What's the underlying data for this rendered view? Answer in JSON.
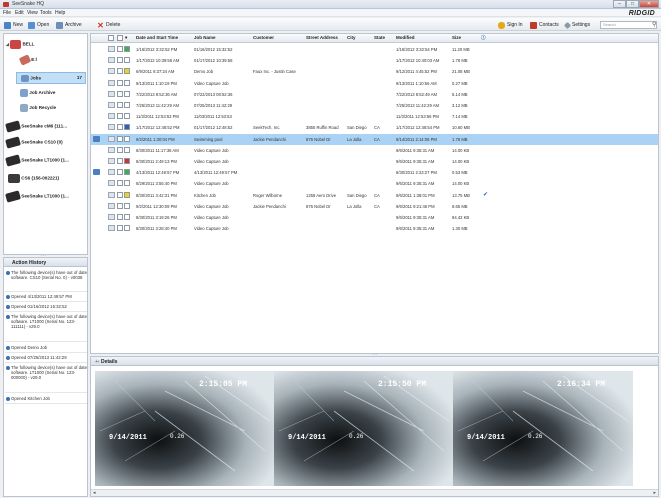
{
  "window": {
    "title": "SeeSnake HQ",
    "brand": "RIDGID"
  },
  "menu": [
    "File",
    "Edit",
    "View",
    "Tools",
    "Help"
  ],
  "toolbar": {
    "new": "New",
    "open": "Open",
    "archive": "Archive",
    "delete": "Delete",
    "sign_in": "Sign In",
    "contacts": "Contacts",
    "settings": "Settings",
    "search_placeholder": "Search"
  },
  "tree": [
    {
      "label": "BELL"
    },
    {
      "label": "E:\\"
    },
    {
      "label": "Jobs",
      "count": "17"
    },
    {
      "label": "Job Archive"
    },
    {
      "label": "Job Recycle"
    },
    {
      "label": "SeeSnake cM6 (111..."
    },
    {
      "label": "SeeSnake CS10 (0)"
    },
    {
      "label": "SeeSnake LT1000 (1..."
    },
    {
      "label": "CS6 (156-002221)"
    },
    {
      "label": "SeeSnake LT1000 (1..."
    }
  ],
  "history": {
    "title": "Action History",
    "items": [
      "The following device(s) have out of date software. CS10 (Serial No. 0) - v0038",
      "Opened 4/13/2011 12:49:57 PM",
      "Opened 01/16/2012 15:32:52",
      "The following device(s) have out of date software. LT1000 (Serial No. 123-111111) - v29.0",
      "Opened Demo Job",
      "Opened 07/25/2013 11:42:29",
      "The following device(s) have out of date software. LT1000 (Serial No. 123-000000) - v29.0",
      "Opened Kitchen Job"
    ]
  },
  "grid": {
    "columns": [
      "Date and Start Time",
      "Job Name",
      "Customer",
      "Street Address",
      "City",
      "State",
      "Modified",
      "Size"
    ],
    "rows": [
      {
        "color": "#3fae49",
        "date": "1/16/2012 3:32:52 PM",
        "job": "01/16/2012 15:32:52",
        "customer": "",
        "street": "",
        "city": "",
        "state": "",
        "modified": "1/16/2012 3:32:54 PM",
        "size": "11.20 MB"
      },
      {
        "color": "#ffffff",
        "date": "1/17/2012 10:39:58 AM",
        "job": "01/17/2012 10:39:58",
        "customer": "",
        "street": "",
        "city": "",
        "state": "",
        "modified": "1/17/2012 10:40:03 AM",
        "size": "1.78 MB"
      },
      {
        "color": "#f2d21b",
        "date": "6/9/2011 8:37:24 AM",
        "job": "Demo Job",
        "customer": "Faux Inc. - Justin Case",
        "street": "",
        "city": "",
        "state": "",
        "modified": "9/12/2011 4:45:52 PM",
        "size": "21.08 MB"
      },
      {
        "color": "#ffffff",
        "date": "9/13/2011 1:10:19 PM",
        "job": "Video Capture Job",
        "customer": "",
        "street": "",
        "city": "",
        "state": "",
        "modified": "9/13/2011 1:10:56 AM",
        "size": "0.27 MB"
      },
      {
        "color": "#ffffff",
        "date": "7/22/2013 8:52:36 AM",
        "job": "07/22/2013 08:52:36",
        "customer": "",
        "street": "",
        "city": "",
        "state": "",
        "modified": "7/22/2013 8:52:49 AM",
        "size": "5.14 MB"
      },
      {
        "color": "#ffffff",
        "date": "7/25/2013 11:42:29 AM",
        "job": "07/25/2013 11:42:29",
        "customer": "",
        "street": "",
        "city": "",
        "state": "",
        "modified": "7/25/2013 11:42:29 AM",
        "size": "3.12 MB"
      },
      {
        "color": "#ffffff",
        "date": "11/3/2011 12:53:53 PM",
        "job": "11/03/2011 12:53:53",
        "customer": "",
        "street": "",
        "city": "",
        "state": "",
        "modified": "11/3/2011 12:53:56 PM",
        "size": "7.14 MB"
      },
      {
        "color": "#2d5fb8",
        "date": "1/17/2012 12:48:52 PM",
        "job": "01/17/2012 12:48:52",
        "customer": "SeekTech, Inc.",
        "street": "3855 Ruffin Road",
        "city": "San Diego",
        "state": "CA",
        "modified": "1/17/2012 12:48:54 PM",
        "size": "10.60 MB"
      },
      {
        "color": "#ffffff",
        "date": "9/2/2011 1:30:04 PM",
        "job": "Swimming pool",
        "customer": "Jackie Pendanchi",
        "street": "876 Nobel Dr",
        "city": "La Jolla",
        "state": "CA",
        "modified": "9/14/2011 2:14:06 PM",
        "size": "1.78 MB",
        "selected": true
      },
      {
        "color": "#ffffff",
        "date": "8/30/2011 11:17:36 AM",
        "job": "Video Capture Job",
        "customer": "",
        "street": "",
        "city": "",
        "state": "",
        "modified": "9/6/2011 9:35:31 AM",
        "size": "14.00 KB"
      },
      {
        "color": "#d62f2f",
        "date": "8/30/2011 2:49:13 PM",
        "job": "Video Capture Job",
        "customer": "",
        "street": "",
        "city": "",
        "state": "",
        "modified": "9/6/2011 9:35:31 AM",
        "size": "14.00 KB"
      },
      {
        "color": "#3fae49",
        "date": "4/13/2011 12:49:57 PM",
        "job": "4/13/2011 12:49:57 PM",
        "customer": "",
        "street": "",
        "city": "",
        "state": "",
        "modified": "8/30/2011 2:23:27 PM",
        "size": "0.53 MB",
        "badge": true
      },
      {
        "color": "#ffffff",
        "date": "8/29/2011 3:55:40 PM",
        "job": "Video Capture Job",
        "customer": "",
        "street": "",
        "city": "",
        "state": "",
        "modified": "9/6/2011 9:35:31 AM",
        "size": "14.00 KB"
      },
      {
        "color": "#f2d21b",
        "date": "8/30/2011 3:42:31 PM",
        "job": "Kitchen Job",
        "customer": "Roger Wilborne",
        "street": "1258 Aero Drive",
        "city": "San Diego",
        "state": "CA",
        "modified": "9/6/2011 1:38:01 PM",
        "size": "13.75 MB",
        "check": true
      },
      {
        "color": "#ffffff",
        "date": "9/2/2011 12:30:09 PM",
        "job": "Video Capture Job",
        "customer": "Jackie Pendanchi",
        "street": "876 Nobel Dr",
        "city": "La Jolla",
        "state": "CA",
        "modified": "9/6/2011 9:21:46 PM",
        "size": "8.65 MB"
      },
      {
        "color": "#ffffff",
        "date": "8/30/2011 3:19:26 PM",
        "job": "Video Capture Job",
        "customer": "",
        "street": "",
        "city": "",
        "state": "",
        "modified": "9/6/2011 9:35:31 AM",
        "size": "94.42 KB"
      },
      {
        "color": "#ffffff",
        "date": "8/30/2011 3:28:40 PM",
        "job": "Video Capture Job",
        "customer": "",
        "street": "",
        "city": "",
        "state": "",
        "modified": "9/6/2011 9:35:31 AM",
        "size": "1.30 MB"
      }
    ]
  },
  "details": {
    "title": "Details",
    "thumbs": [
      {
        "time": "2:15:05 PM",
        "date": "9/14/2011",
        "dist": "0.26"
      },
      {
        "time": "2:15:50 PM",
        "date": "9/14/2011",
        "dist": "0.26"
      },
      {
        "time": "2:16:34 PM",
        "date": "9/14/2011",
        "dist": "0.26"
      }
    ]
  },
  "colors": {
    "selection": "#aad2f4",
    "accent": "#3a6fb0"
  },
  "icons": [
    "new-icon",
    "open-icon",
    "archive-icon",
    "delete-icon",
    "sign-in-icon",
    "contacts-icon",
    "settings-icon",
    "search-icon"
  ]
}
